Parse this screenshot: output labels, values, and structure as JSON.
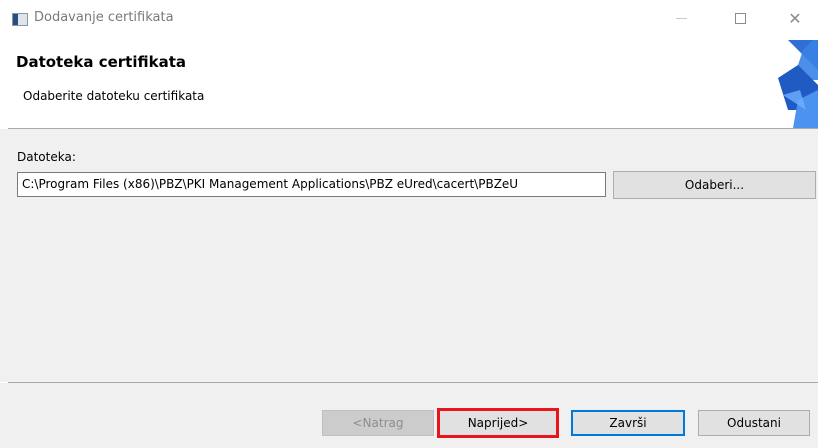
{
  "window": {
    "title": "Dodavanje certifikata",
    "icon": "certificate-app-icon",
    "controls": [
      "minimize-icon",
      "maximize-icon",
      "close-icon"
    ]
  },
  "header": {
    "title": "Datoteka certifikata",
    "description": "Odaberite datoteku certifikata"
  },
  "content": {
    "file_label": "Datoteka:",
    "file_path": "C:\\Program Files (x86)\\PBZ\\PKI Management Applications\\PBZ eUred\\cacert\\PBZeU",
    "browse_label": "Odaberi..."
  },
  "footer": {
    "back_label": "<Natrag",
    "next_label": "Naprijed>",
    "finish_label": "Završi",
    "cancel_label": "Odustani"
  },
  "colors": {
    "highlight": "#e8161c",
    "default_button_border": "#0078d7",
    "panel_background": "#f0f0f0"
  }
}
